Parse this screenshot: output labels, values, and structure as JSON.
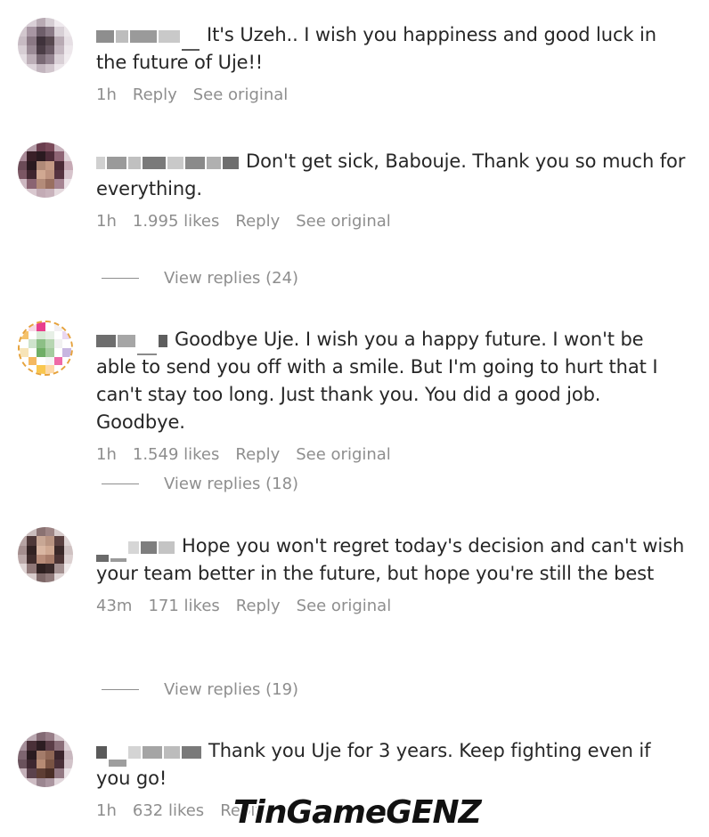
{
  "comments": [
    {
      "text": "It's Uzeh.. I wish you happiness and good luck in the future of Uje!!",
      "time": "1h",
      "likes": "",
      "reply": "Reply",
      "see_original": "See original",
      "replies": ""
    },
    {
      "text": "Don't get sick, Babouje. Thank you so much for everything.",
      "time": "1h",
      "likes": "1.995 likes",
      "reply": "Reply",
      "see_original": "See original",
      "replies": "View replies (24)"
    },
    {
      "text": "Goodbye Uje. I wish you a happy future. I won't be able to send you off with a smile. But I'm going to hurt that I can't stay too long. Just thank you. You did a good job. Goodbye.",
      "time": "1h",
      "likes": "1.549 likes",
      "reply": "Reply",
      "see_original": "See original",
      "replies": "View replies (18)"
    },
    {
      "text": "Hope you won't regret today's decision and can't wish your team better in the future, but hope you're still the best",
      "time": "43m",
      "likes": "171 likes",
      "reply": "Reply",
      "see_original": "See original",
      "replies": "View replies (19)"
    },
    {
      "text": "Thank you Uje for 3 years. Keep fighting even if you go!",
      "time": "1h",
      "likes": "632 likes",
      "reply": "Reply",
      "see_original": "",
      "replies": ""
    }
  ],
  "watermark": {
    "part1": "TinGame",
    "part2": "GENZ"
  },
  "colors": {
    "text": "#262626",
    "muted": "#8e8e8e"
  }
}
